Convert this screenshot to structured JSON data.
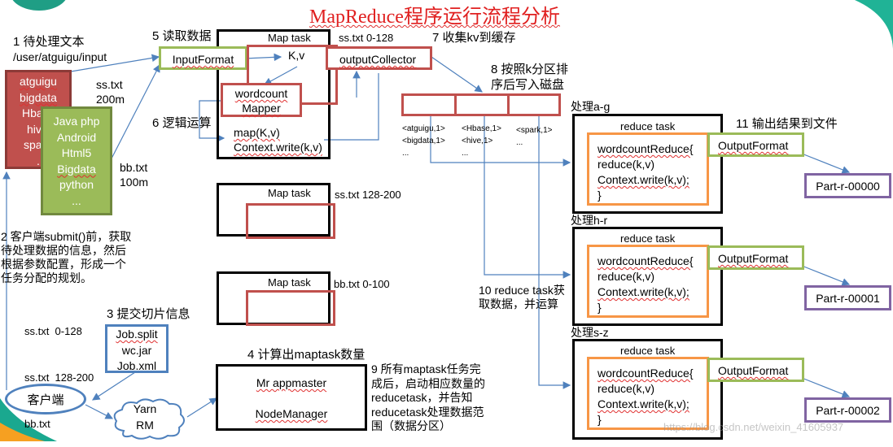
{
  "title": "MapReduce程序运行流程分析",
  "steps": {
    "s1_title": "1 待处理文本",
    "s1_path": "/user/atguigu/input",
    "s2_lines": [
      "2 客户端submit()前，获取",
      "待处理数据的信息，然后",
      "根据参数配置，形成一个",
      "任务分配的规划。"
    ],
    "s2_splits": [
      "ss.txt  0-128",
      "ss.txt  128-200",
      "bb.txt"
    ],
    "s3": "3 提交切片信息",
    "s4": "4 计算出maptask数量",
    "s5": "5 读取数据",
    "s6": "6 逻辑运算",
    "s7": "7 收集kv到缓存",
    "s8_lines": [
      "8 按照k分区排",
      "序后写入磁盘"
    ],
    "s9_lines": [
      "9 所有maptask任务完",
      "成后，启动相应数量的",
      "reducetask，并告知",
      "reducetask处理数据范",
      "围（数据分区）"
    ],
    "s10_lines": [
      "10 reduce task获",
      "取数据，并运算"
    ],
    "s11": "11 输出结果到文件"
  },
  "files": {
    "ss": {
      "name": "ss.txt",
      "size": "200m",
      "words": [
        "atguigu",
        "bigdata",
        "Hbase",
        "hive",
        "spark",
        "..."
      ]
    },
    "bb": {
      "name": "bb.txt",
      "size": "100m",
      "words": [
        "Java php",
        "Android",
        "Html5",
        "Bigdata",
        "python",
        "..."
      ]
    }
  },
  "map_tasks": [
    {
      "label": "Map task",
      "split": "ss.txt 0-128"
    },
    {
      "label": "Map task",
      "split": "ss.txt 128-200"
    },
    {
      "label": "Map task",
      "split": "bb.txt 0-100"
    }
  ],
  "map_detail": {
    "input_format": "InputFormat",
    "kv": "K,v",
    "output_collector": "outputCollector",
    "mapper_lines": [
      "wordcount",
      "Mapper"
    ],
    "map_code": [
      "map(K,v)",
      "Context.write(k,v)"
    ]
  },
  "partitions": [
    {
      "items": [
        "<atguigu,1>",
        "<bigdata,1>",
        "..."
      ]
    },
    {
      "items": [
        "<Hbase,1>",
        "<hive,1>",
        "..."
      ]
    },
    {
      "items": [
        "<spark,1>",
        "..."
      ]
    }
  ],
  "reduce_tasks": [
    {
      "range": "处理a-g",
      "label": "reduce task",
      "code": [
        "wordcountReduce{",
        "reduce(k,v)",
        "Context.write(k,v);",
        "}"
      ],
      "output_format": "OutputFormat",
      "part": "Part-r-00000"
    },
    {
      "range": "处理h-r",
      "label": "reduce task",
      "code": [
        "wordcountReduce{",
        "reduce(k,v)",
        "Context.write(k,v);",
        "}"
      ],
      "output_format": "OutputFormat",
      "part": "Part-r-00001"
    },
    {
      "range": "处理s-z",
      "label": "reduce task",
      "code": [
        "wordcountReduce{",
        "reduce(k,v)",
        "Context.write(k,v);",
        "}"
      ],
      "output_format": "OutputFormat",
      "part": "Part-r-00002"
    }
  ],
  "job_files": [
    "Job.split",
    "wc.jar",
    "Job.xml"
  ],
  "client": "客户端",
  "yarn_lines": [
    "Yarn",
    "RM"
  ],
  "appmaster": {
    "line1": "Mr appmaster",
    "line2": "NodeManager"
  },
  "watermark": "https://blog.csdn.net/weixin_41605937",
  "colors": {
    "title": "#e02020",
    "red_box": "#c0504d",
    "green_box": "#9bbb59",
    "orange_box": "#f79646",
    "purple_box": "#8064a2",
    "blue_box": "#4f81bd",
    "teal_decor": "#1aa88f"
  }
}
